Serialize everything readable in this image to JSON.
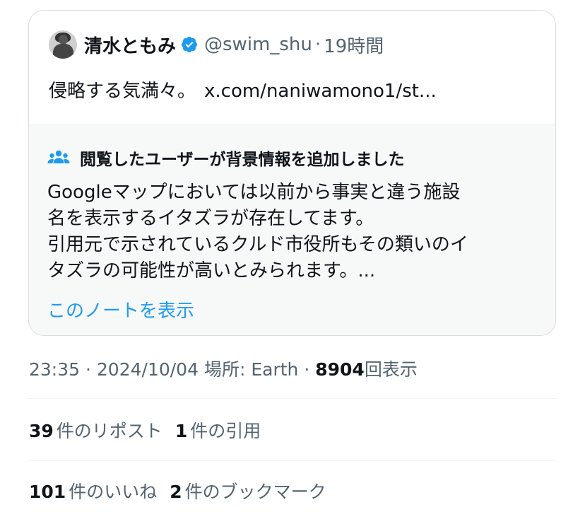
{
  "quote": {
    "display_name": "清水ともみ",
    "handle": "@swim_shu",
    "separator": "·",
    "time": "19時間",
    "text": "侵略する気満々。",
    "link": "x.com/naniwamono1/st..."
  },
  "community_note": {
    "title": "閲覧したユーザーが背景情報を追加しました",
    "body_lines": [
      "Googleマップにおいては以前から事実と違う施設",
      "名を表示するイタズラが存在してます。",
      "引用元で示されているクルド市役所もその類いのイ",
      "タズラの可能性が高いとみられます。..."
    ],
    "show_note_label": "このノートを表示"
  },
  "meta": {
    "time": "23:35",
    "separator": "·",
    "date": "2024/10/04",
    "location": "場所: Earth",
    "views_count": "8904",
    "views_label": "回表示"
  },
  "stats": {
    "reposts_count": "39",
    "reposts_label": "件のリポスト",
    "quotes_count": "1",
    "quotes_label": "件の引用",
    "likes_count": "101",
    "likes_label": "件のいいね",
    "bookmarks_count": "2",
    "bookmarks_label": "件のブックマーク"
  },
  "colors": {
    "accent": "#1d9bf0",
    "secondary_text": "#536471",
    "primary_text": "#0f1419",
    "note_background": "#f7f9f9"
  },
  "icons": {
    "verified": "verified-badge-icon",
    "note": "people-icon"
  }
}
